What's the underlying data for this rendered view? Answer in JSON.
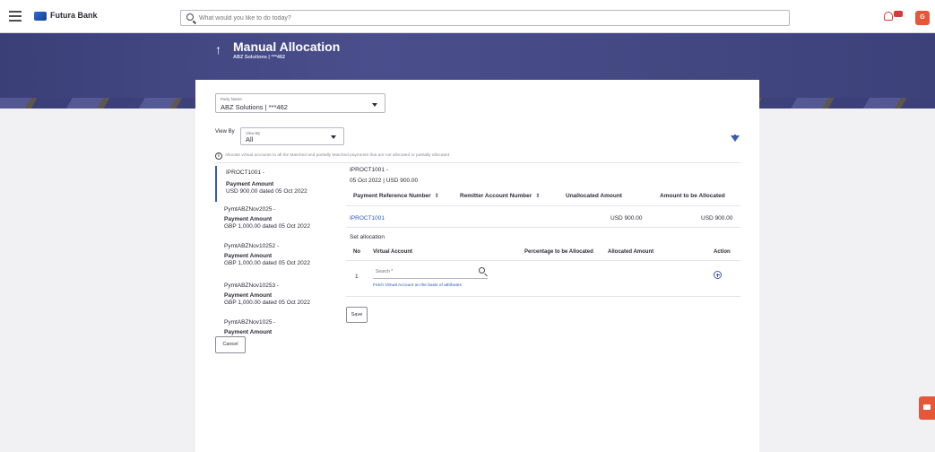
{
  "topbar": {
    "brand": "Futura Bank",
    "search_placeholder": "What would you like to do today?",
    "avatar_initial": "G"
  },
  "header": {
    "title": "Manual Allocation",
    "subtitle": "ABZ Solutions | ***462"
  },
  "party": {
    "label": "Party Name",
    "value": "ABZ Solutions | ***462"
  },
  "view_by": {
    "outer_label": "View By",
    "label": "View By",
    "value": "All"
  },
  "info_text": "Allocate virtual accounts to all the Matched and partially Matched payments that are not allocated or partially allocated",
  "payments": [
    {
      "ref": "IPROCT1001 -",
      "amt_label": "Payment Amount",
      "amt": "USD 900.00 dated 05 Oct 2022"
    },
    {
      "ref": "PymtABZNov2025 -",
      "amt_label": "Payment Amount",
      "amt": "GBP 1,000.00 dated 05 Oct 2022"
    },
    {
      "ref": "PymtABZNov10252 -",
      "amt_label": "Payment Amount",
      "amt": "GBP 1,000.00 dated 05 Oct 2022"
    },
    {
      "ref": "PymtABZNov10253 -",
      "amt_label": "Payment Amount",
      "amt": "GBP 1,000.00 dated 05 Oct 2022"
    },
    {
      "ref": "PymtABZNov1025 -",
      "amt_label": "Payment Amount",
      "amt": ""
    }
  ],
  "detail": {
    "ref": "IPROCT1001 -",
    "meta": "05 Oct 2022 | USD 900.00",
    "columns": [
      "Payment Reference Number",
      "Remitter Account Number",
      "Unallocated Amount",
      "Amount to be Allocated"
    ],
    "row": {
      "payment_ref": "IPROCT1001",
      "remitter": "",
      "unallocated": "USD 900.00",
      "to_allocate": "USD 900.00"
    },
    "set_allocation": "Set allocation",
    "alloc_columns": [
      "No",
      "Virtual Account",
      "Percentage to be Allocated",
      "Allocated Amount",
      "Action"
    ],
    "alloc_row": {
      "no": "1",
      "search_placeholder": "Search *"
    },
    "fetch_link": "Fetch Virtual Account on the basis of attributes"
  },
  "buttons": {
    "save": "Save",
    "cancel": "Cancel"
  },
  "colors": {
    "accent": "#3c5ab5",
    "header_band": "#3b3f78",
    "chat": "#e8563a"
  },
  "icons": [
    "menu-icon",
    "bank-logo-icon",
    "search-icon",
    "bell-icon",
    "filter-icon",
    "info-icon",
    "add-circle-icon",
    "chat-icon",
    "back-arrow-icon"
  ]
}
